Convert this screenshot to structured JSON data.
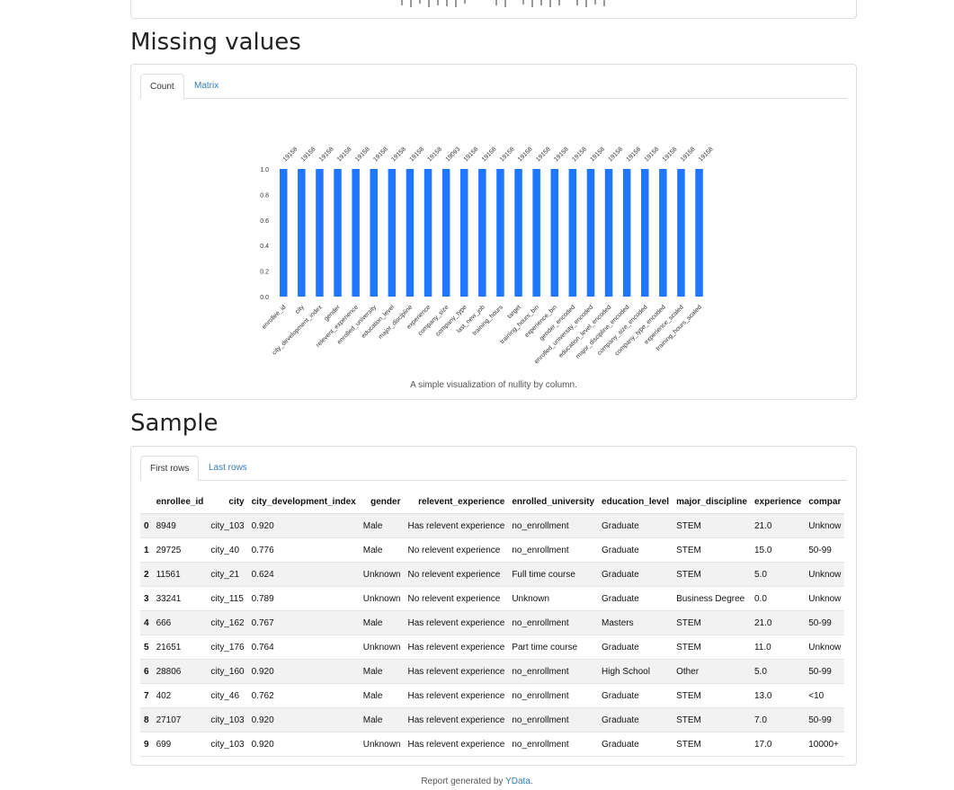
{
  "sections": {
    "missing_values": "Missing values",
    "sample": "Sample"
  },
  "missing_tabs": [
    "Count",
    "Matrix"
  ],
  "sample_tabs": [
    "First rows",
    "Last rows"
  ],
  "chart_caption": "A simple visualization of nullity by column.",
  "footer": {
    "prefix": "Report generated by ",
    "link": "YData",
    "suffix": "."
  },
  "colors": {
    "bar": "#1f77ff",
    "link": "#337ab7"
  },
  "chart_data": {
    "type": "bar",
    "categories": [
      "enrollee_id",
      "city",
      "city_development_index",
      "gender",
      "relevent_experience",
      "enrolled_university",
      "education_level",
      "major_discipline",
      "experience",
      "company_size",
      "company_type",
      "last_new_job",
      "training_hours",
      "target",
      "training_hours_bin",
      "experience_bin",
      "gender_encoded",
      "enrolled_university_encoded",
      "education_level_encoded",
      "major_discipline_encoded",
      "company_size_encoded",
      "company_type_encoded",
      "experience_scaled",
      "training_hours_scaled"
    ],
    "values": [
      1.0,
      1.0,
      1.0,
      1.0,
      1.0,
      1.0,
      1.0,
      1.0,
      1.0,
      1.0,
      1.0,
      1.0,
      1.0,
      1.0,
      1.0,
      1.0,
      1.0,
      1.0,
      1.0,
      1.0,
      1.0,
      1.0,
      1.0,
      1.0
    ],
    "counts": [
      "19158",
      "19158",
      "19158",
      "19158",
      "19158",
      "19158",
      "19158",
      "19158",
      "19158",
      "19093",
      "19158",
      "19158",
      "19158",
      "19158",
      "19158",
      "19158",
      "19158",
      "19158",
      "19158",
      "19158",
      "19158",
      "19158",
      "19158",
      "19158"
    ],
    "yticks": [
      "0.0",
      "0.2",
      "0.4",
      "0.6",
      "0.8",
      "1.0"
    ],
    "ylim": [
      0,
      1.0
    ]
  },
  "table": {
    "columns": [
      "",
      "enrollee_id",
      "city",
      "city_development_index",
      "gender",
      "relevent_experience",
      "enrolled_university",
      "education_level",
      "major_discipline",
      "experience",
      "compar"
    ],
    "rows": [
      [
        "0",
        "8949",
        "city_103",
        "0.920",
        "Male",
        "Has relevent experience",
        "no_enrollment",
        "Graduate",
        "STEM",
        "21.0",
        "Unknow"
      ],
      [
        "1",
        "29725",
        "city_40",
        "0.776",
        "Male",
        "No relevent experience",
        "no_enrollment",
        "Graduate",
        "STEM",
        "15.0",
        "50-99"
      ],
      [
        "2",
        "11561",
        "city_21",
        "0.624",
        "Unknown",
        "No relevent experience",
        "Full time course",
        "Graduate",
        "STEM",
        "5.0",
        "Unknow"
      ],
      [
        "3",
        "33241",
        "city_115",
        "0.789",
        "Unknown",
        "No relevent experience",
        "Unknown",
        "Graduate",
        "Business Degree",
        "0.0",
        "Unknow"
      ],
      [
        "4",
        "666",
        "city_162",
        "0.767",
        "Male",
        "Has relevent experience",
        "no_enrollment",
        "Masters",
        "STEM",
        "21.0",
        "50-99"
      ],
      [
        "5",
        "21651",
        "city_176",
        "0.764",
        "Unknown",
        "Has relevent experience",
        "Part time course",
        "Graduate",
        "STEM",
        "11.0",
        "Unknow"
      ],
      [
        "6",
        "28806",
        "city_160",
        "0.920",
        "Male",
        "Has relevent experience",
        "no_enrollment",
        "High School",
        "Other",
        "5.0",
        "50-99"
      ],
      [
        "7",
        "402",
        "city_46",
        "0.762",
        "Male",
        "Has relevent experience",
        "no_enrollment",
        "Graduate",
        "STEM",
        "13.0",
        "<10"
      ],
      [
        "8",
        "27107",
        "city_103",
        "0.920",
        "Male",
        "Has relevent experience",
        "no_enrollment",
        "Graduate",
        "STEM",
        "7.0",
        "50-99"
      ],
      [
        "9",
        "699",
        "city_103",
        "0.920",
        "Unknown",
        "Has relevent experience",
        "no_enrollment",
        "Graduate",
        "STEM",
        "17.0",
        "10000+"
      ]
    ]
  }
}
